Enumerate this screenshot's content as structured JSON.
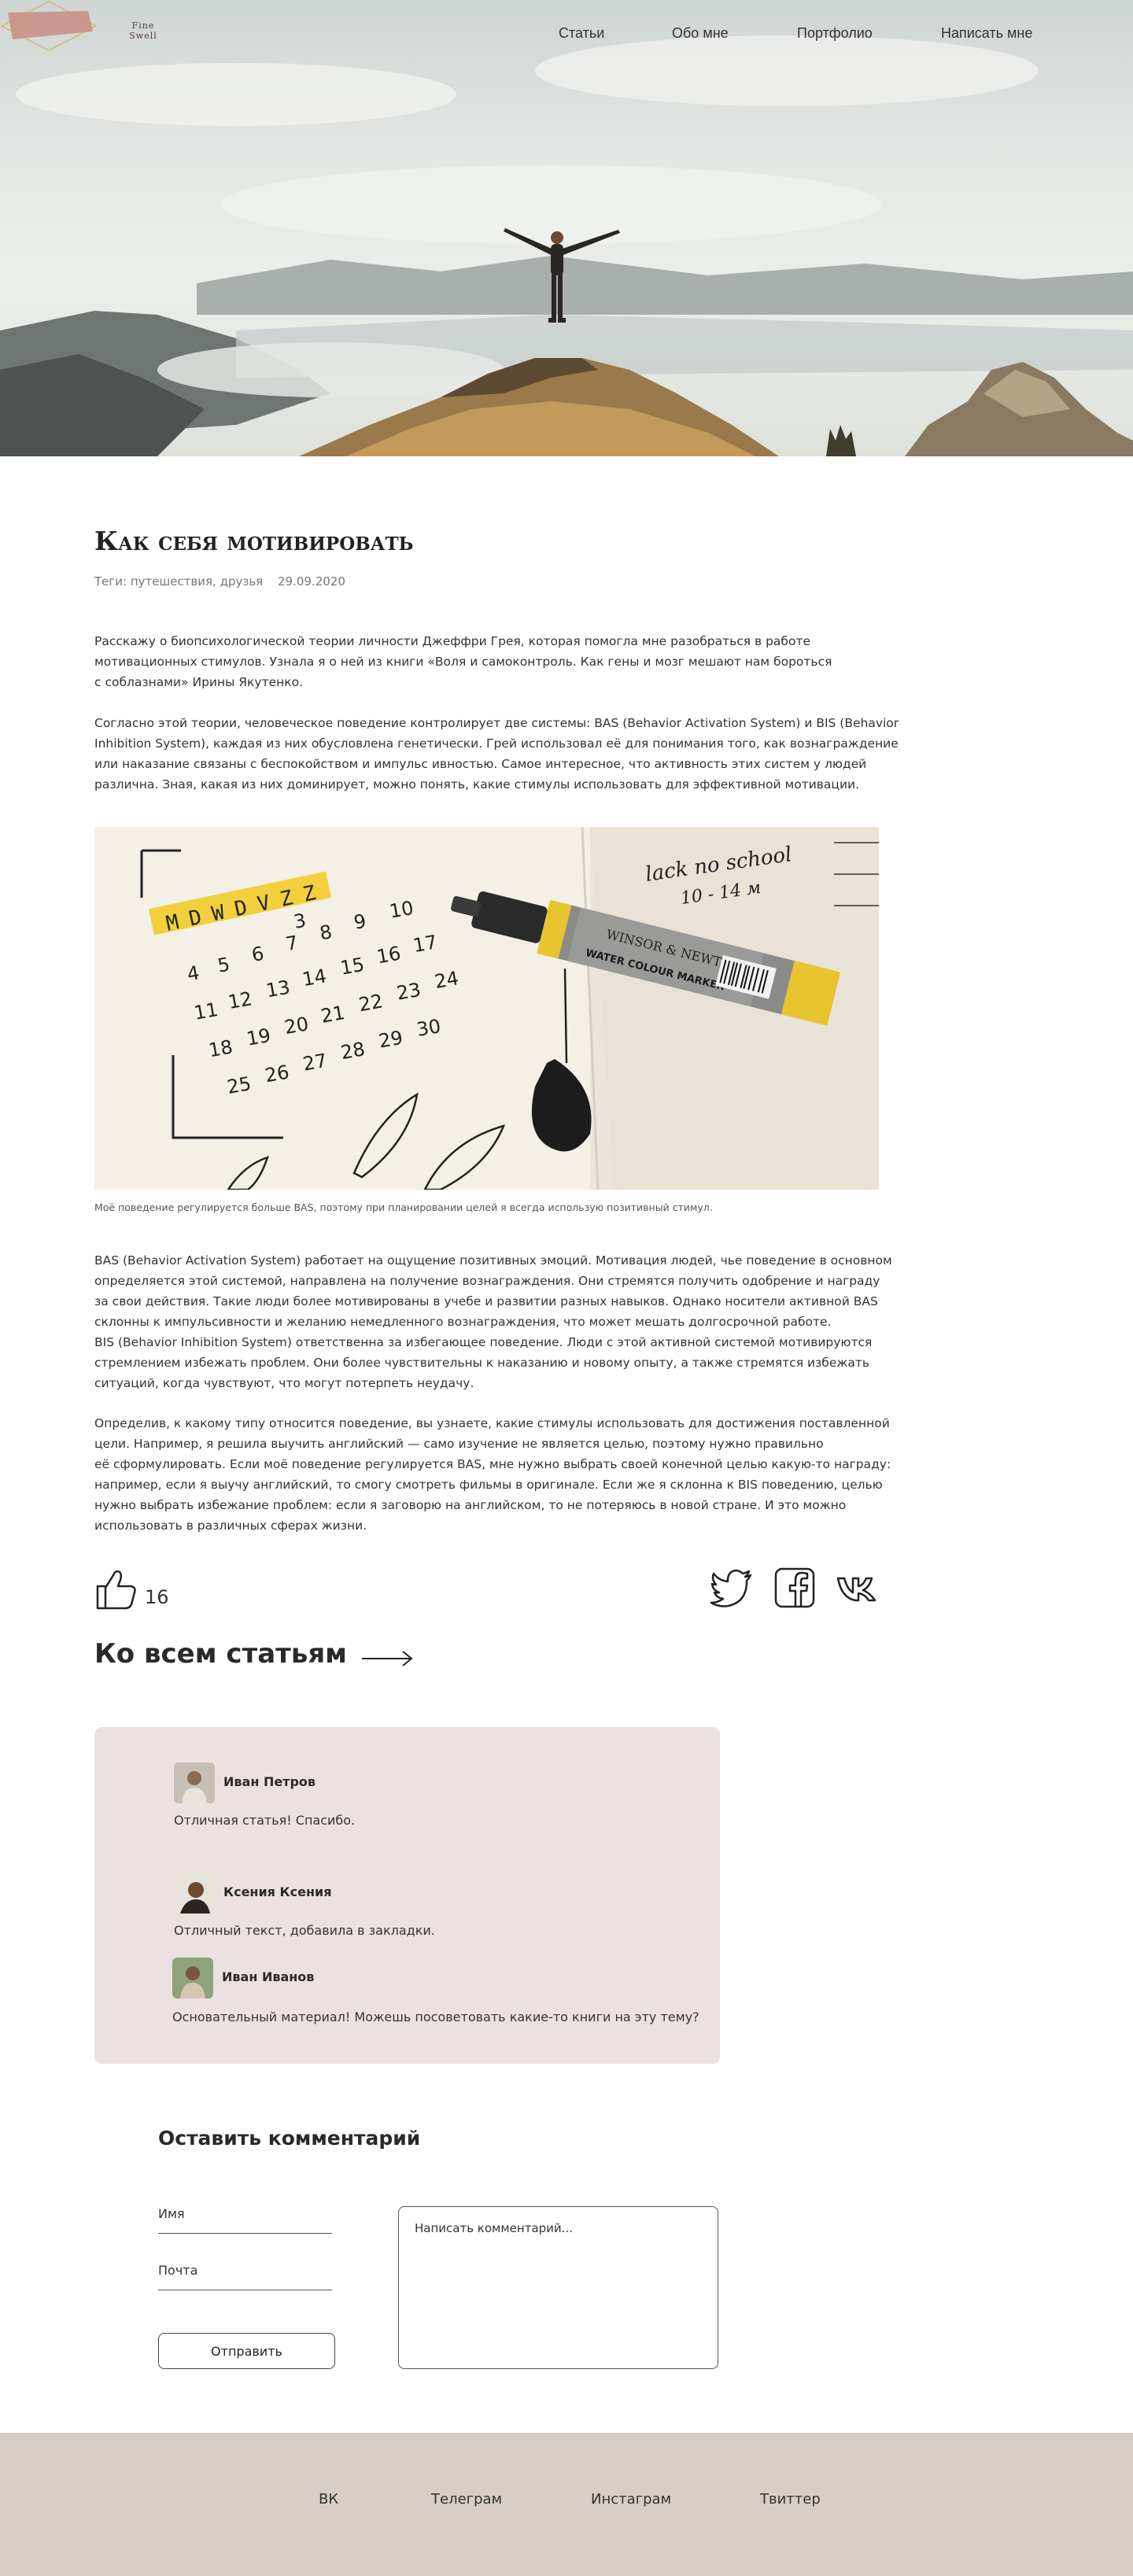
{
  "brand": {
    "logo_text_line1": "Fine",
    "logo_text_line2": "Swell"
  },
  "nav": {
    "items": [
      {
        "label": "Статьи"
      },
      {
        "label": "Обо мне"
      },
      {
        "label": "Портфолио"
      },
      {
        "label": "Написать мне"
      }
    ]
  },
  "article": {
    "title": "Как себя мотивировать",
    "tags": "Теги: путешествия, друзья",
    "date": "29.09.2020",
    "intro": [
      "Расскажу о биопсихологической теории личности Джеффри Грея, которая помогла мне разобраться в работе",
      "мотивационных стимулов. Узнала я о ней из книги «Воля и самоконтроль. Как гены и мозг мешают нам бороться",
      "с соблазнами» Ирины Якутенко."
    ],
    "theory": [
      "Согласно этой теории, человеческое поведение контролирует две системы: BAS (Behavior Activation System) и BIS (Behavior",
      "Inhibition System), каждая из них обусловлена генетически. Грей использовал её для понимания того, как вознаграждение",
      "или наказание связаны с беспокойством и импульс   ивностью. Самое интересное, что активность этих систем у людей",
      "различна. Зная, какая из них доминирует, можно понять, какие стимулы использовать для эффективной мотивации."
    ],
    "photo_caption": "Моё поведение регулируется больше BAS, поэтому при планировании целей я всегда использую позитивный стимул.",
    "bas_bis": [
      "BAS (Behavior Activation System) работает на ощущение позитивных эмоций. Мотивация людей, чье поведение в основном",
      "определяется этой системой, направлена на получение вознаграждения. Они стремятся получить одобрение и награду",
      "за свои действия. Такие люди более мотивированы в учебе и развитии разных навыков. Однако носители активной BAS",
      "склонны к импульсивности и желанию немедленного вознаграждения, что может мешать долгосрочной работе.",
      "BIS (Behavior Inhibition System) ответственна за избегающее поведение. Люди с этой активной системой мотивируются",
      "стремлением избежать проблем. Они более чувствительны к наказанию и новому опыту, а также стремятся избежать",
      "ситуаций, когда чувствуют, что могут потерпеть неудачу."
    ],
    "conclusion": [
      "Определив, к какому типу относится поведение, вы узнаете, какие стимулы использовать для достижения поставленной",
      "цели. Например, я решила выучить английский — само изучение не является целью, поэтому нужно правильно",
      "её сформулировать. Если моё поведение регулируется BAS, мне нужно выбрать своей конечной целью какую-то награду:",
      "например, если я выучу английский, то смогу смотреть фильмы в оригинале. Если же я склонна к BIS поведению, целью",
      "нужно выбрать избежание проблем: если я заговорю на английском, то не потеряюсь в новой стране. И это можно",
      "использовать в различных сферах жизни."
    ],
    "likes": "16"
  },
  "calendar_photo": {
    "letters": [
      "M",
      "D",
      "W",
      "D",
      "V",
      "Z",
      "Z"
    ],
    "pen_brand": "WINSOR & NEWTON",
    "pen_label": "WATER COLOUR MARKER",
    "note": "lack no school",
    "note_sub": "10 - 14 м"
  },
  "back_link": "Ко всем статьям",
  "comments": [
    {
      "name": "Иван Петров",
      "text": "Отличная статья! Спасибо."
    },
    {
      "name": "Ксения Ксения",
      "text": "Отличный текст, добавила в закладки."
    },
    {
      "name": "Иван Иванов",
      "text": "Основательный материал! Можешь посоветовать какие-то книги на эту тему?"
    }
  ],
  "form": {
    "title": "Оставить комментарий",
    "name_label": "Имя",
    "email_label": "Почта",
    "comment_placeholder": "Написать комментарий...",
    "submit_label": "Отправить"
  },
  "footer": {
    "links": [
      {
        "label": "ВК"
      },
      {
        "label": "Телеграм"
      },
      {
        "label": "Инстаграм"
      },
      {
        "label": "Твиттер"
      }
    ]
  },
  "colors": {
    "comments_bg": "#ebe1e1",
    "footer_bg": "#d6cec7",
    "text": "#333333",
    "logo_accent": "#c98d84"
  }
}
